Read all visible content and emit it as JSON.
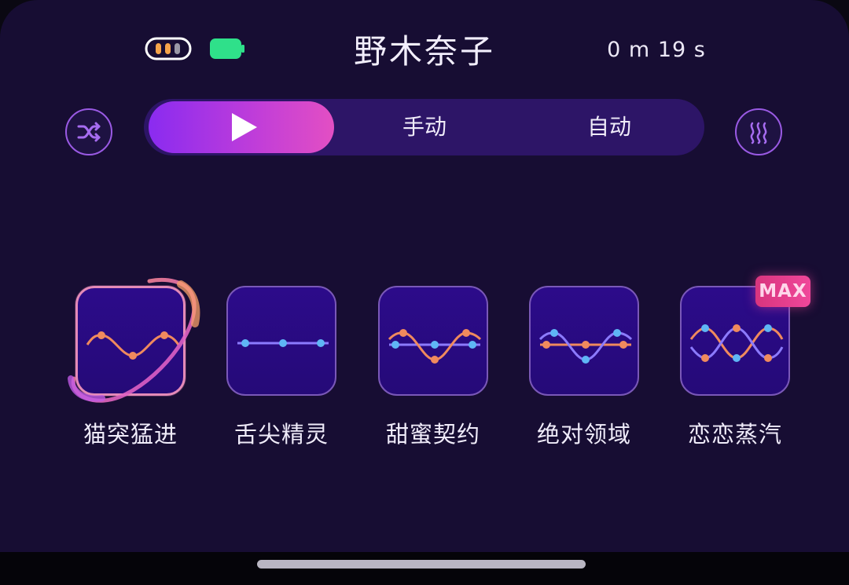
{
  "header": {
    "title": "野木奈子",
    "timer": "0 m 19 s",
    "icons": {
      "connection": "signal-dots-icon",
      "battery": "battery-icon"
    },
    "colors": {
      "connection_dot_left": "#f5a34a",
      "connection_dot_mid": "#f5a34a",
      "connection_dot_right": "#9a98a6",
      "battery": "#2fe08a"
    }
  },
  "mode_bar": {
    "left_button_icon": "shuffle-icon",
    "right_button_icon": "heat-wave-icon",
    "active_icon": "play-icon",
    "tabs": [
      {
        "label": "手动"
      },
      {
        "label": "自动"
      }
    ],
    "accent_gradient": [
      "#8a2bf0",
      "#e34fc3"
    ]
  },
  "patterns": [
    {
      "label": "猫突猛进",
      "selected": true
    },
    {
      "label": "舌尖精灵",
      "selected": false
    },
    {
      "label": "甜蜜契约",
      "selected": false
    },
    {
      "label": "绝对领域",
      "selected": false
    },
    {
      "label": "恋恋蒸汽",
      "selected": false,
      "badge": "MAX"
    }
  ],
  "colors": {
    "background": "#170d33",
    "tile": "#2c0b8a",
    "wave_orange": "#f08a5d",
    "wave_blue": "#8c7bff",
    "dot_blue": "#5fb6f5"
  }
}
